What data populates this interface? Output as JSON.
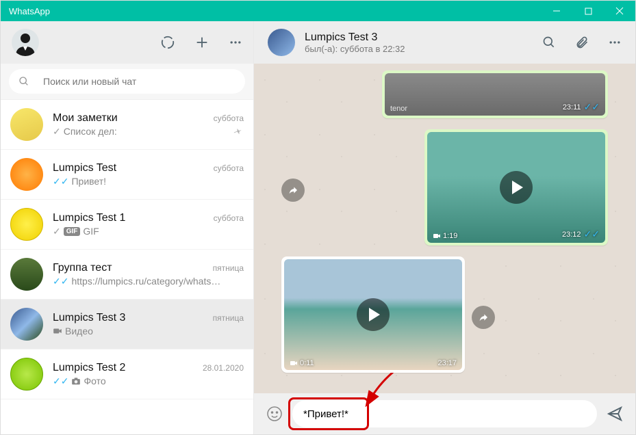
{
  "app": {
    "title": "WhatsApp"
  },
  "search": {
    "placeholder": "Поиск или новый чат"
  },
  "chats": [
    {
      "name": "Мои заметки",
      "time": "суббота",
      "preview": "Список дел:",
      "check": "gray",
      "pinned": true
    },
    {
      "name": "Lumpics Test",
      "time": "суббота",
      "preview": "Привет!",
      "check": "blue"
    },
    {
      "name": "Lumpics Test 1",
      "time": "суббота",
      "preview": "GIF",
      "check": "gray",
      "gif": true
    },
    {
      "name": "Группа тест",
      "time": "пятница",
      "preview": "https://lumpics.ru/category/whats…",
      "check": "blue"
    },
    {
      "name": "Lumpics Test 3",
      "time": "пятница",
      "preview": "Видео",
      "video_icon": true,
      "active": true
    },
    {
      "name": "Lumpics Test 2",
      "time": "28.01.2020",
      "preview": "Фото",
      "check": "blue",
      "photo_icon": true
    }
  ],
  "contact": {
    "name": "Lumpics Test 3",
    "status": "был(-а): суббота в 22:32"
  },
  "messages": {
    "gif": {
      "watermark": "tenor",
      "time": "23:11"
    },
    "vid1": {
      "duration": "1:19",
      "time": "23:12"
    },
    "vid2": {
      "duration": "0:11",
      "time": "23:17"
    }
  },
  "compose": {
    "value": "*Привет!*"
  }
}
